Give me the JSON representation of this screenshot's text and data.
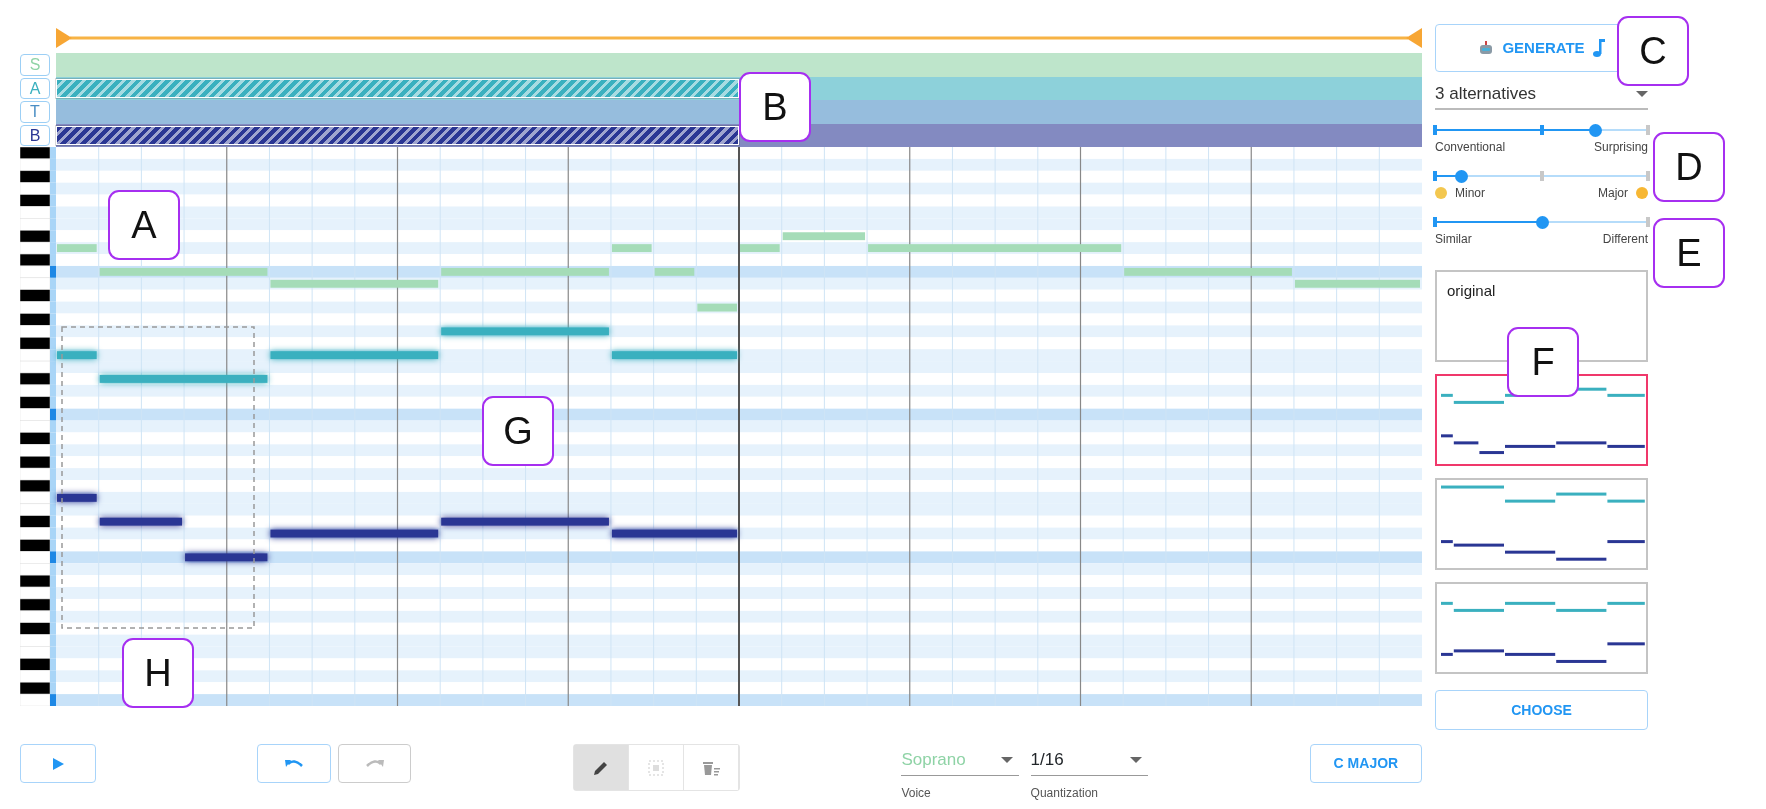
{
  "voices": [
    {
      "label": "S",
      "color": "#8fd3a6",
      "masked": false
    },
    {
      "label": "A",
      "color": "#3ab0bf",
      "masked": true
    },
    {
      "label": "T",
      "color": "#4a8ec4",
      "masked": false
    },
    {
      "label": "B",
      "color": "#2a3694",
      "masked": true
    }
  ],
  "panel": {
    "generate_button": "GENERATE",
    "alternatives_dropdown": "3 alternatives",
    "sliders": [
      {
        "left_label": "Conventional",
        "right_label": "Surprising",
        "level": 0.75
      },
      {
        "kind": "mood",
        "left_label": "Minor",
        "right_label": "Major",
        "level": 0.12
      },
      {
        "left_label": "Similar",
        "right_label": "Different",
        "level": 0.5
      }
    ],
    "previews": [
      {
        "kind": "original",
        "label": "original",
        "selected": false
      },
      {
        "kind": "alternative",
        "selected": true
      },
      {
        "kind": "alternative",
        "selected": false
      },
      {
        "kind": "alternative",
        "selected": false
      }
    ],
    "choose_button": "CHOOSE"
  },
  "toolbar": {
    "undo_disabled": false,
    "redo_disabled": true,
    "tools": [
      {
        "kind": "pencil",
        "selected": true,
        "disabled": false
      },
      {
        "kind": "select",
        "selected": false,
        "disabled": true
      },
      {
        "kind": "erase",
        "selected": false,
        "disabled": false
      }
    ],
    "voice": {
      "value": "Soprano",
      "label": "Voice"
    },
    "quantization": {
      "value": "1/16",
      "label": "Quantization"
    },
    "key_button": "C MAJOR"
  },
  "callouts": [
    {
      "label": "A"
    },
    {
      "label": "B"
    },
    {
      "label": "C"
    },
    {
      "label": "D"
    },
    {
      "label": "E"
    },
    {
      "label": "F"
    },
    {
      "label": "G"
    },
    {
      "label": "H"
    }
  ]
}
